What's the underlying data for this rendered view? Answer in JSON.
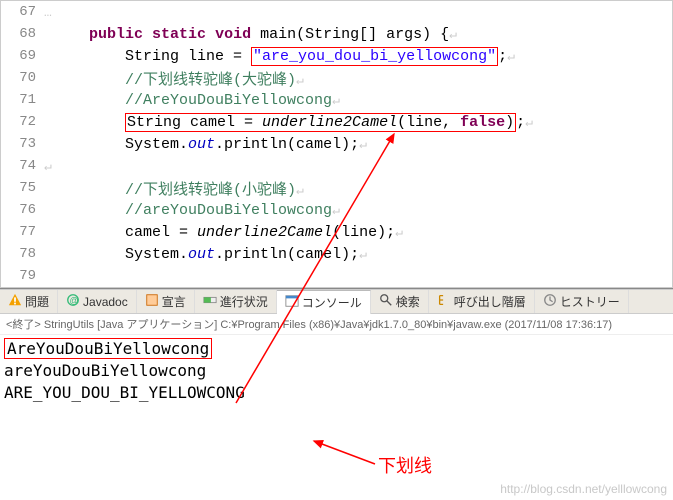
{
  "editor": {
    "lines": [
      {
        "no": "67",
        "html": "<span class='eol'>…</span>"
      },
      {
        "no": "68",
        "html": "     <span class='kw-purple'>public</span> <span class='kw-purple'>static</span> <span class='kw-purple'>void</span> main(String[] args) {<span class='eol'>↵</span>"
      },
      {
        "no": "69",
        "html": "         String line = <span class='box-red'><span class='str'>\"are_you_dou_bi_yellowcong\"</span></span>;<span class='eol'>↵</span>"
      },
      {
        "no": "70",
        "html": "         <span class='comment'>//下划线转驼峰(大驼峰)</span><span class='eol'>↵</span>"
      },
      {
        "no": "71",
        "html": "         <span class='comment'>//AreYouDouBiYellowcong</span><span class='eol'>↵</span>"
      },
      {
        "no": "72",
        "html": "         <span class='box-red'>String camel = <span class='ital'>underline2Camel</span>(line, <span class='kw-purple'>false</span>)</span>;<span class='eol'>↵</span>"
      },
      {
        "no": "73",
        "html": "         System.<span class='kw-blue'>out</span>.println(camel);<span class='eol'>↵</span>"
      },
      {
        "no": "74",
        "html": "<span class='eol'>↵</span>"
      },
      {
        "no": "75",
        "html": "         <span class='comment'>//下划线转驼峰(小驼峰)</span><span class='eol'>↵</span>"
      },
      {
        "no": "76",
        "html": "         <span class='comment'>//areYouDouBiYellowcong</span><span class='eol'>↵</span>"
      },
      {
        "no": "77",
        "html": "         camel = <span class='ital'>underline2Camel</span>(line);<span class='eol'>↵</span>"
      },
      {
        "no": "78",
        "html": "         System.<span class='kw-blue'>out</span>.println(camel);<span class='eol'>↵</span>"
      },
      {
        "no": "79",
        "html": ""
      }
    ]
  },
  "tabs": [
    {
      "label": "問題",
      "icon": "warn"
    },
    {
      "label": "Javadoc",
      "icon": "at"
    },
    {
      "label": "宣言",
      "icon": "decl"
    },
    {
      "label": "進行状況",
      "icon": "prog"
    },
    {
      "label": "コンソール",
      "icon": "console",
      "active": true
    },
    {
      "label": "検索",
      "icon": "search"
    },
    {
      "label": "呼び出し階層",
      "icon": "call"
    },
    {
      "label": "ヒストリー",
      "icon": "hist"
    }
  ],
  "status_line": "<終了> StringUtils [Java アプリケーション] C:¥Program Files (x86)¥Java¥jdk1.7.0_80¥bin¥javaw.exe (2017/11/08 17:36:17)",
  "console": {
    "lines": [
      {
        "text": "AreYouDouBiYellowcong",
        "boxed": true
      },
      {
        "text": "areYouDouBiYellowcong",
        "boxed": false
      },
      {
        "text": "ARE_YOU_DOU_BI_YELLOWCONG",
        "boxed": false
      }
    ]
  },
  "annotation": "下划线",
  "watermark": "http://blog.csdn.net/yelllowcong"
}
